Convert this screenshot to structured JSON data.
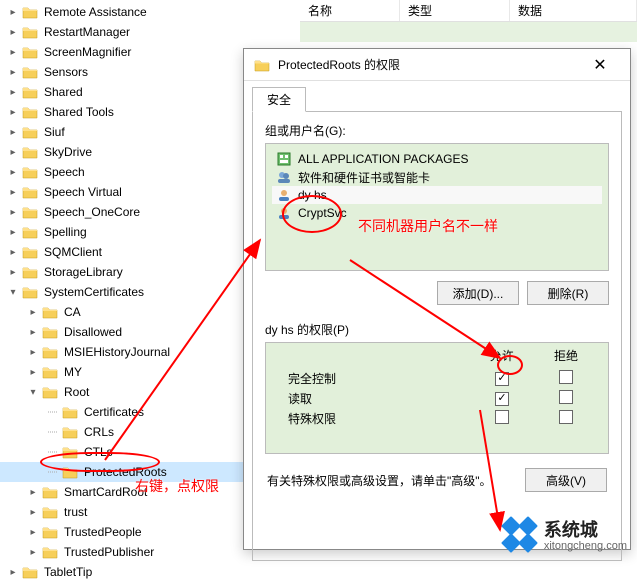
{
  "list_headers": {
    "name": "名称",
    "type": "类型",
    "data": "数据"
  },
  "tree": {
    "items": [
      {
        "label": "Remote Assistance",
        "indent": "indent-1",
        "type": "closed",
        "selected": false
      },
      {
        "label": "RestartManager",
        "indent": "indent-1",
        "type": "closed",
        "selected": false
      },
      {
        "label": "ScreenMagnifier",
        "indent": "indent-1",
        "type": "closed",
        "selected": false
      },
      {
        "label": "Sensors",
        "indent": "indent-1",
        "type": "closed",
        "selected": false
      },
      {
        "label": "Shared",
        "indent": "indent-1",
        "type": "closed",
        "selected": false
      },
      {
        "label": "Shared Tools",
        "indent": "indent-1",
        "type": "closed",
        "selected": false
      },
      {
        "label": "Siuf",
        "indent": "indent-1",
        "type": "closed",
        "selected": false
      },
      {
        "label": "SkyDrive",
        "indent": "indent-1",
        "type": "closed",
        "selected": false
      },
      {
        "label": "Speech",
        "indent": "indent-1",
        "type": "closed",
        "selected": false
      },
      {
        "label": "Speech Virtual",
        "indent": "indent-1",
        "type": "closed",
        "selected": false
      },
      {
        "label": "Speech_OneCore",
        "indent": "indent-1",
        "type": "closed",
        "selected": false
      },
      {
        "label": "Spelling",
        "indent": "indent-1",
        "type": "closed",
        "selected": false
      },
      {
        "label": "SQMClient",
        "indent": "indent-1",
        "type": "closed",
        "selected": false
      },
      {
        "label": "StorageLibrary",
        "indent": "indent-1",
        "type": "closed",
        "selected": false
      },
      {
        "label": "SystemCertificates",
        "indent": "indent-1",
        "type": "open",
        "selected": false
      },
      {
        "label": "CA",
        "indent": "indent-2",
        "type": "closed",
        "selected": false
      },
      {
        "label": "Disallowed",
        "indent": "indent-2",
        "type": "closed",
        "selected": false
      },
      {
        "label": "MSIEHistoryJournal",
        "indent": "indent-2",
        "type": "closed",
        "selected": false
      },
      {
        "label": "MY",
        "indent": "indent-2",
        "type": "closed",
        "selected": false
      },
      {
        "label": "Root",
        "indent": "indent-2",
        "type": "open",
        "selected": false
      },
      {
        "label": "Certificates",
        "indent": "indent-3",
        "type": "leaf",
        "selected": false
      },
      {
        "label": "CRLs",
        "indent": "indent-3",
        "type": "leaf",
        "selected": false
      },
      {
        "label": "CTLs",
        "indent": "indent-3",
        "type": "leaf",
        "selected": false
      },
      {
        "label": "ProtectedRoots",
        "indent": "indent-3",
        "type": "leaf",
        "selected": true
      },
      {
        "label": "SmartCardRoot",
        "indent": "indent-2",
        "type": "closed",
        "selected": false
      },
      {
        "label": "trust",
        "indent": "indent-2",
        "type": "closed",
        "selected": false
      },
      {
        "label": "TrustedPeople",
        "indent": "indent-2",
        "type": "closed",
        "selected": false
      },
      {
        "label": "TrustedPublisher",
        "indent": "indent-2",
        "type": "closed",
        "selected": false
      },
      {
        "label": "TabletTip",
        "indent": "indent-1",
        "type": "closed",
        "selected": false
      }
    ]
  },
  "dialog": {
    "title": "ProtectedRoots 的权限",
    "tab_security": "安全",
    "group_label": "组或用户名(G):",
    "groups": [
      "ALL APPLICATION PACKAGES",
      "软件和硬件证书或智能卡",
      "dy hs",
      "CryptSvc"
    ],
    "add_btn": "添加(D)...",
    "remove_btn": "删除(R)",
    "perm_for": "dy hs 的权限(P)",
    "perm_allow": "允许",
    "perm_deny": "拒绝",
    "perms": [
      {
        "name": "完全控制",
        "allow": true,
        "deny": false
      },
      {
        "name": "读取",
        "allow": true,
        "deny": false
      },
      {
        "name": "特殊权限",
        "allow": false,
        "deny": false
      }
    ],
    "adv_note": "有关特殊权限或高级设置，请单击\"高级\"。",
    "adv_btn": "高级(V)"
  },
  "annotations": {
    "right_click_note": "右键，点权限",
    "user_varies_note": "不同机器用户名不一样"
  },
  "watermark": {
    "title": "系统城",
    "url": "xitongcheng.com"
  }
}
